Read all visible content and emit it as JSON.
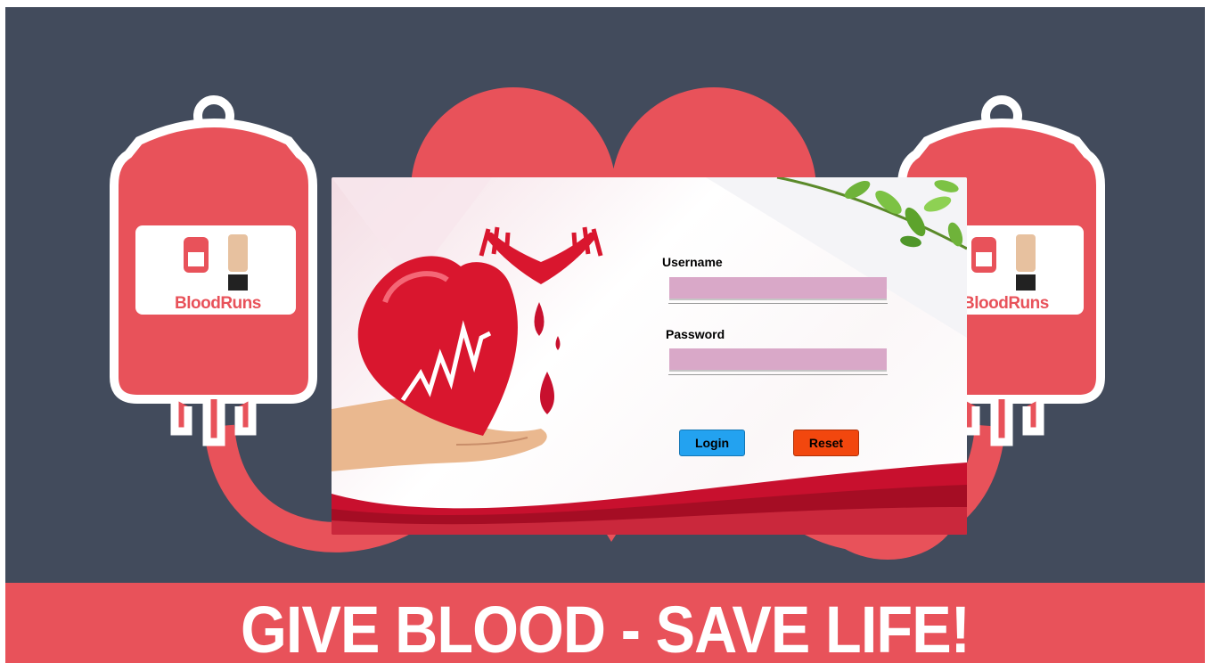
{
  "brand": {
    "name_left": "BloodRuns",
    "name_right": "BloodRuns"
  },
  "banner": {
    "text": "GIVE BLOOD - SAVE LIFE!"
  },
  "login": {
    "username_label": "Username",
    "username_value": "",
    "password_label": "Password",
    "password_value": "",
    "login_label": "Login",
    "reset_label": "Reset"
  },
  "colors": {
    "background": "#424b5c",
    "accent_red": "#e8525a",
    "input_fill": "#d9a8c8",
    "login_button": "#23a2f0",
    "reset_button": "#f2470e"
  },
  "icons": [
    "blood-bag-icon",
    "raised-fist-icon",
    "heart-icon",
    "hands-icon",
    "blood-drop-icon",
    "leaves-icon"
  ]
}
